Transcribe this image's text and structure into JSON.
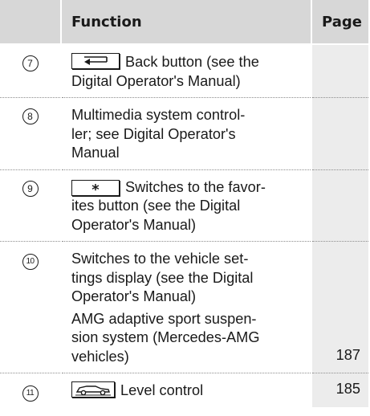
{
  "table": {
    "headers": {
      "function": "Function",
      "page": "Page"
    },
    "rows": [
      {
        "number": "7",
        "icon": "back-key-icon",
        "lines": [
          "Back button (see the",
          "Digital Operator's Manual)"
        ],
        "page": ""
      },
      {
        "number": "8",
        "icon": "",
        "lines": [
          "Multimedia system control-",
          "ler; see Digital Operator's",
          "Manual"
        ],
        "page": ""
      },
      {
        "number": "9",
        "icon": "favorites-star-key-icon",
        "lines": [
          "Switches to the favor-",
          "ites button (see the Digital",
          "Operator's Manual)"
        ],
        "page": ""
      },
      {
        "number": "10",
        "icon": "",
        "lines": [
          "Switches to the vehicle set-",
          "tings display (see the Digital",
          "Operator's Manual)"
        ],
        "lines2": [
          "AMG adaptive sport suspen-",
          "sion system (Mercedes-AMG",
          "vehicles)"
        ],
        "page": "187"
      },
      {
        "number": "11",
        "icon": "level-control-car-icon",
        "lines": [
          "Level control"
        ],
        "page": "185"
      }
    ]
  },
  "colors": {
    "header_bg": "#d7d7d7",
    "page_col_bg": "#ececec",
    "row_divider": "#8c8c8c",
    "text": "#1a1a1a"
  }
}
